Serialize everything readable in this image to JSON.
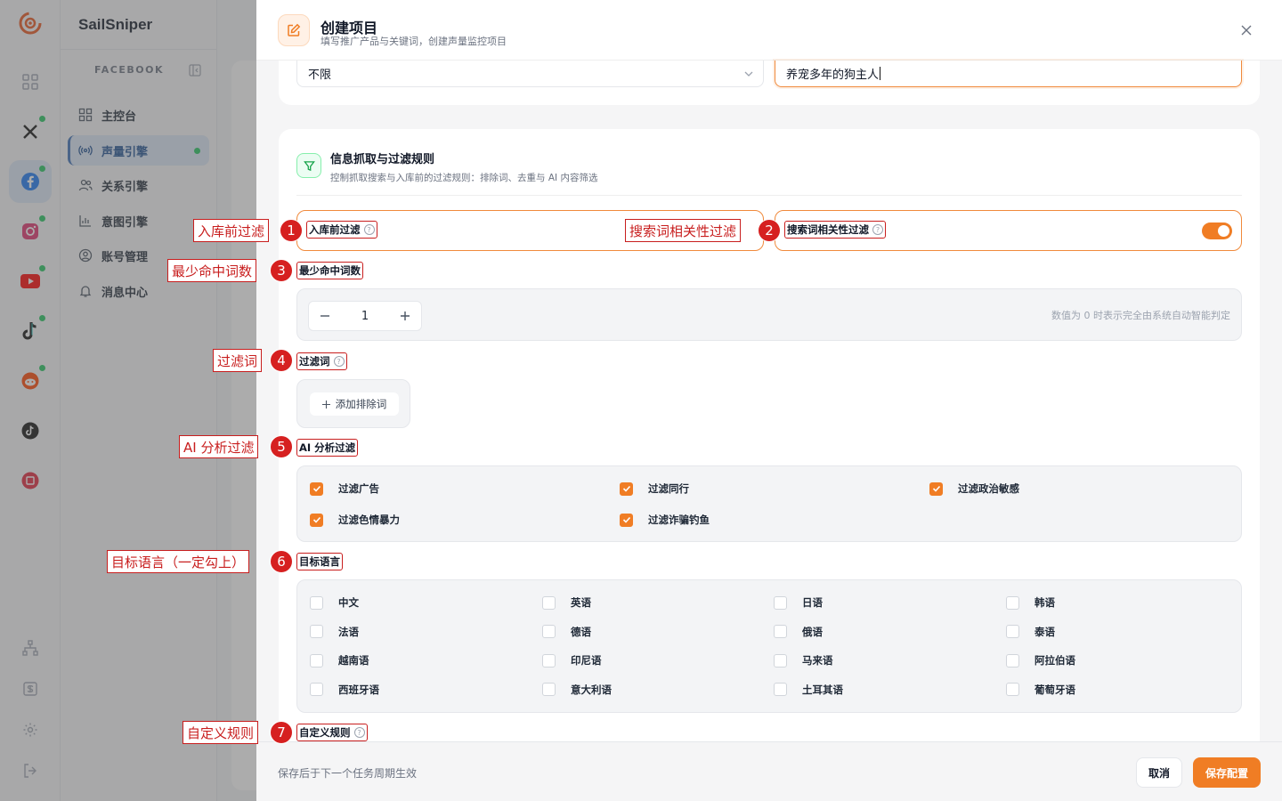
{
  "app": {
    "brand": "SailSniper",
    "platform_label": "FACEBOOK",
    "nav": [
      {
        "label": "主控台"
      },
      {
        "label": "声量引擎"
      },
      {
        "label": "关系引擎"
      },
      {
        "label": "意图引擎"
      },
      {
        "label": "账号管理"
      },
      {
        "label": "消息中心"
      }
    ],
    "rail_icons": [
      "dashboard-icon",
      "x-icon",
      "facebook-icon",
      "instagram-icon",
      "youtube-icon",
      "tiktok-icon",
      "reddit-icon",
      "tiktok-alt-icon",
      "xiaohongshu-icon"
    ],
    "accent_color": "#f07d24",
    "active_color": "#1d4f91"
  },
  "drawer": {
    "title": "创建项目",
    "subtitle": "填写推广产品与关键词，创建声量监控项目",
    "top": {
      "select_value": "不限",
      "input_value": "养宠多年的狗主人"
    },
    "section": {
      "title": "信息抓取与过滤规则",
      "subtitle": "控制抓取搜索与入库前的过滤规则：排除词、去重与 AI 内容筛选"
    },
    "fields": {
      "pre_filter": "入库前过滤",
      "relevance_filter": "搜索词相关性过滤",
      "min_hits": "最少命中词数",
      "min_hits_value": "1",
      "min_hits_hint": "数值为 0 时表示完全由系统自动智能判定",
      "filter_words": "过滤词",
      "add_exclude": "添加排除词",
      "ai_filter": "AI 分析过滤",
      "target_lang": "目标语言",
      "custom_rules": "自定义规则"
    },
    "relevance_toggle_on": true,
    "ai_options": [
      {
        "label": "过滤广告",
        "checked": true
      },
      {
        "label": "过滤同行",
        "checked": true
      },
      {
        "label": "过滤政治敏感",
        "checked": true
      },
      {
        "label": "过滤色情暴力",
        "checked": true
      },
      {
        "label": "过滤诈骗钓鱼",
        "checked": true
      }
    ],
    "languages": [
      {
        "label": "中文",
        "checked": false
      },
      {
        "label": "英语",
        "checked": false
      },
      {
        "label": "日语",
        "checked": false
      },
      {
        "label": "韩语",
        "checked": false
      },
      {
        "label": "法语",
        "checked": false
      },
      {
        "label": "德语",
        "checked": false
      },
      {
        "label": "俄语",
        "checked": false
      },
      {
        "label": "泰语",
        "checked": false
      },
      {
        "label": "越南语",
        "checked": false
      },
      {
        "label": "印尼语",
        "checked": false
      },
      {
        "label": "马来语",
        "checked": false
      },
      {
        "label": "阿拉伯语",
        "checked": false
      },
      {
        "label": "西班牙语",
        "checked": false
      },
      {
        "label": "意大利语",
        "checked": false
      },
      {
        "label": "土耳其语",
        "checked": false
      },
      {
        "label": "葡萄牙语",
        "checked": false
      }
    ],
    "footer": {
      "note": "保存后于下一个任务周期生效",
      "cancel": "取消",
      "save": "保存配置"
    }
  },
  "annotations": [
    {
      "num": "1",
      "label": "入库前过滤"
    },
    {
      "num": "2",
      "label": "搜索词相关性过滤"
    },
    {
      "num": "3",
      "label": "最少命中词数"
    },
    {
      "num": "4",
      "label": "过滤词"
    },
    {
      "num": "5",
      "label": "AI 分析过滤"
    },
    {
      "num": "6",
      "label": "目标语言（一定勾上）"
    },
    {
      "num": "7",
      "label": "自定义规则"
    }
  ]
}
